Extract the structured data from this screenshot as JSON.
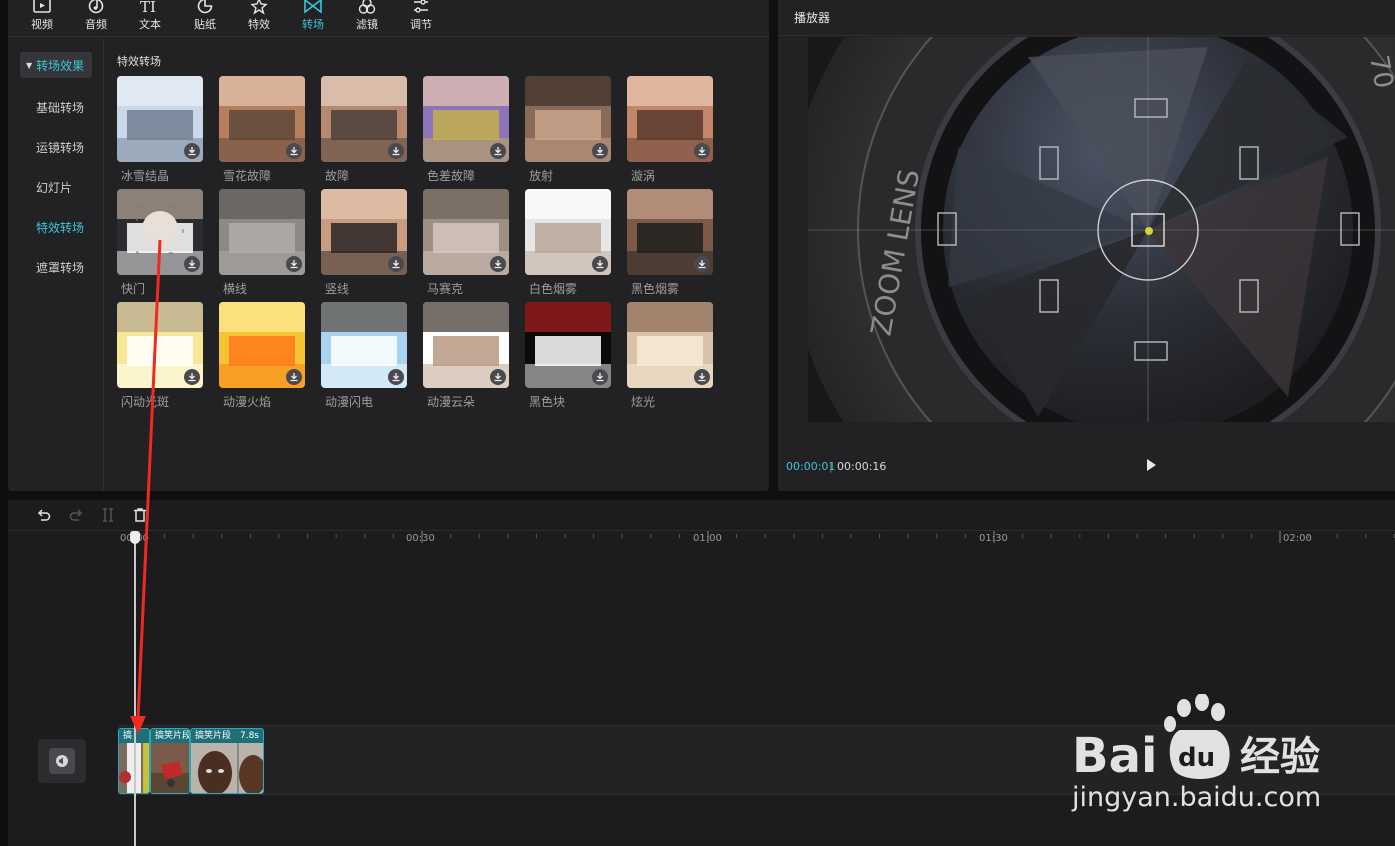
{
  "toolbar": {
    "items": [
      {
        "label": "视频",
        "icon": "video-icon"
      },
      {
        "label": "音频",
        "icon": "music-note-icon"
      },
      {
        "label": "文本",
        "icon": "text-icon"
      },
      {
        "label": "贴纸",
        "icon": "sticker-icon"
      },
      {
        "label": "特效",
        "icon": "sparkle-icon"
      },
      {
        "label": "转场",
        "icon": "transition-icon",
        "active": true
      },
      {
        "label": "滤镜",
        "icon": "filter-icon"
      },
      {
        "label": "调节",
        "icon": "adjust-icon"
      }
    ]
  },
  "side_menu": {
    "header": "转场效果",
    "items": [
      "基础转场",
      "运镜转场",
      "幻灯片",
      "特效转场",
      "遮罩转场"
    ],
    "active": "特效转场"
  },
  "section": {
    "title": "特效转场"
  },
  "transitions": [
    {
      "label": "冰雪结晶"
    },
    {
      "label": "雪花故障"
    },
    {
      "label": "故障"
    },
    {
      "label": "色差故障"
    },
    {
      "label": "放射"
    },
    {
      "label": "漩涡"
    },
    {
      "label": "快门"
    },
    {
      "label": "横线"
    },
    {
      "label": "竖线"
    },
    {
      "label": "马赛克"
    },
    {
      "label": "白色烟雾"
    },
    {
      "label": "黑色烟雾"
    },
    {
      "label": "闪动光斑"
    },
    {
      "label": "动漫火焰"
    },
    {
      "label": "动漫闪电"
    },
    {
      "label": "动漫云朵"
    },
    {
      "label": "黑色块"
    },
    {
      "label": "炫光"
    }
  ],
  "player": {
    "title": "播放器",
    "current_time": "00:00:01",
    "separator": "|",
    "total_time": "00:00:16",
    "lens_text": "ZOOM LENS",
    "lens_text_right": "70"
  },
  "timeline": {
    "ruler_labels": [
      "00:00",
      "00:30",
      "01:00",
      "01:30",
      "02:00"
    ],
    "clips": [
      {
        "caption": "搞"
      },
      {
        "caption": "搞笑片段"
      },
      {
        "caption": "搞笑片段",
        "duration": "7.8s"
      }
    ]
  },
  "watermark": {
    "brand": "Bai",
    "brand2": "du",
    "suffix": "经验",
    "url": "jingyan.baidu.com"
  },
  "colors": {
    "accent": "#3cc5d6",
    "arrow": "#ee2a22",
    "panel": "#222225",
    "clip_border": "#2fa7b6"
  }
}
